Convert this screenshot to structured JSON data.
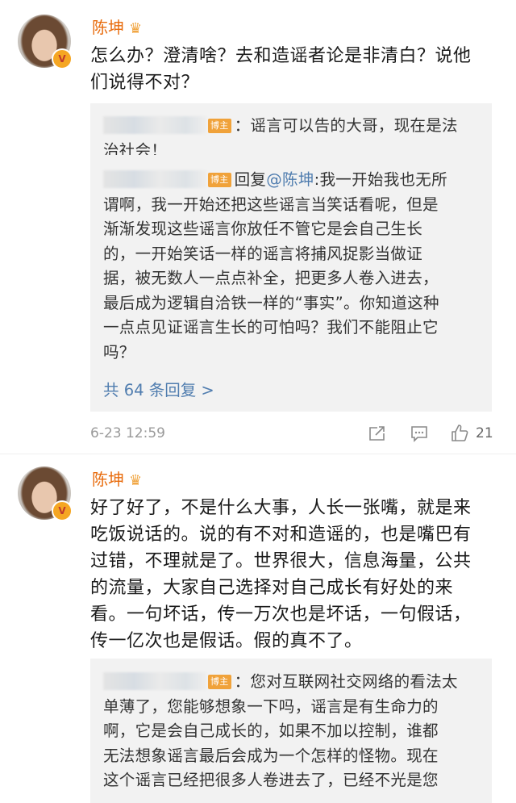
{
  "comments": [
    {
      "username": "陈坤",
      "crown_icon": "crown-icon",
      "verified_badge": "V",
      "lines": [
        "怎么办？澄清啥？去和造谣者论是非清白？说他",
        "们说得不对？"
      ],
      "replies": [
        {
          "tag": "博主",
          "lines_first": "：谣言可以告的大哥，现在是法",
          "lines": [
            "治社会！"
          ]
        },
        {
          "tag": "博主",
          "prefix": "回复",
          "mention": "@陈坤",
          "first": ":我一开始我也无所",
          "lines": [
            "谓啊，我一开始还把这些谣言当笑话看呢，但是",
            "渐渐发现这些谣言你放任不管它是会自己生长",
            "的，一开始笑话一样的谣言将捕风捉影当做证",
            "据，被无数人一点点补全，把更多人卷入进去，",
            "最后成为逻辑自洽铁一样的“事实”。你知道这种",
            "一点点见证谣言生长的可怕吗？我们不能阻止它",
            "吗？"
          ]
        }
      ],
      "more_replies": "共 64 条回复 >",
      "timestamp": "6-23 12:59",
      "like_count": "21"
    },
    {
      "username": "陈坤",
      "crown_icon": "crown-icon",
      "verified_badge": "V",
      "lines": [
        "好了好了，不是什么大事，人长一张嘴，就是来",
        "吃饭说话的。说的有不对和造谣的，也是嘴巴有",
        "过错，不理就是了。世界很大，信息海量，公共",
        "的流量，大家自己选择对自己成长有好处的来",
        "看。一句坏话，传一万次也是坏话，一句假话，",
        "传一亿次也是假话。假的真不了。"
      ],
      "replies": [
        {
          "tag": "博主",
          "first": "：您对互联网社交网络的看法太",
          "lines": [
            "单薄了，您能够想象一下吗，谣言是有生命力的",
            "啊，它是会自己成长的，如果不加以控制，谁都",
            "无法想象谣言最后会成为一个怎样的怪物。现在",
            "这个谣言已经把很多人卷进去了，已经不光是您"
          ]
        }
      ]
    }
  ],
  "colors": {
    "username": "#e86b0c",
    "link": "#507daf",
    "reply_bg": "#f2f2f2",
    "meta": "#9a9a9a",
    "tag": "#f0a23a"
  }
}
